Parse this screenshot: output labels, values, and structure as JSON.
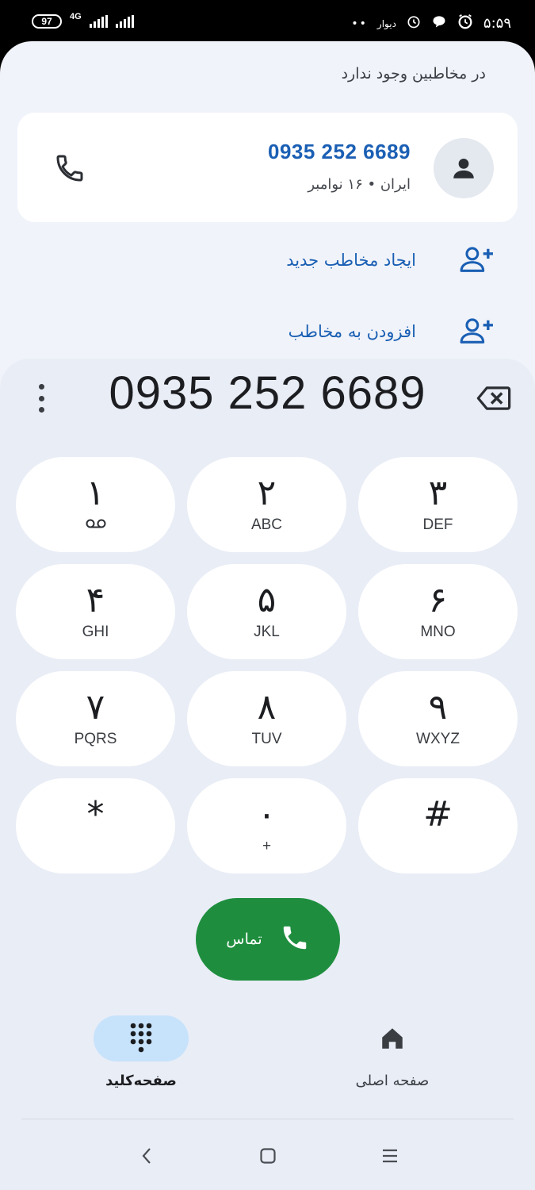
{
  "status_bar": {
    "battery": "97",
    "network": "4G",
    "time": "۵:۵۹",
    "app_label": "دیوار",
    "dots": "••"
  },
  "header": {
    "no_contact": "در مخاطبین وجود ندارد"
  },
  "result_card": {
    "number": "0935 252 6689",
    "subtitle": "ایران • ۱۶ نوامبر"
  },
  "actions": {
    "create_contact": "ایجاد مخاطب جدید",
    "add_to_contact": "افزودن به مخاطب"
  },
  "dialpad": {
    "entered_number": "0935 252 6689",
    "keys": [
      {
        "digit": "۱",
        "letters": ""
      },
      {
        "digit": "۲",
        "letters": "ABC"
      },
      {
        "digit": "۳",
        "letters": "DEF"
      },
      {
        "digit": "۴",
        "letters": "GHI"
      },
      {
        "digit": "۵",
        "letters": "JKL"
      },
      {
        "digit": "۶",
        "letters": "MNO"
      },
      {
        "digit": "۷",
        "letters": "PQRS"
      },
      {
        "digit": "۸",
        "letters": "TUV"
      },
      {
        "digit": "۹",
        "letters": "WXYZ"
      },
      {
        "digit": "*",
        "letters": ""
      },
      {
        "digit": "۰",
        "letters": "+"
      },
      {
        "digit": "#",
        "letters": ""
      }
    ],
    "call_label": "تماس"
  },
  "bottom_nav": {
    "keypad_label": "صفحه‌کلید",
    "home_label": "صفحه اصلی"
  },
  "colors": {
    "accent": "#1a5fb4",
    "call_green": "#1e8e3e",
    "nav_active": "#c7e3fb"
  }
}
